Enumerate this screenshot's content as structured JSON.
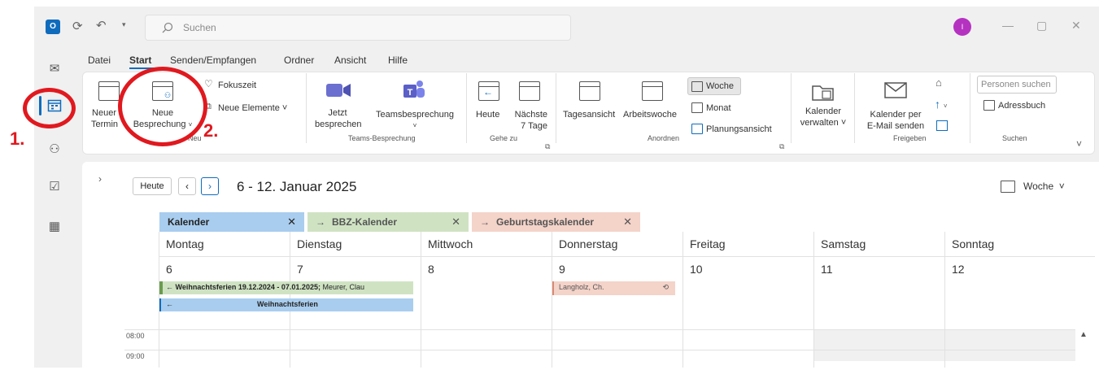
{
  "search": {
    "placeholder": "Suchen"
  },
  "avatar": {
    "initial": "I"
  },
  "menu": {
    "tabs": [
      "Datei",
      "Start",
      "Senden/Empfangen",
      "Ordner",
      "Ansicht",
      "Hilfe"
    ],
    "active": "Start"
  },
  "ribbon": {
    "new_appointment": "Neuer Termin",
    "new_meeting_line1": "Neue",
    "new_meeting_line2": "Besprechung",
    "focus_time": "Fokuszeit",
    "new_items": "Neue Elemente",
    "group_new": "Neu",
    "meet_now_line1": "Jetzt",
    "meet_now_line2": "besprechen",
    "teams_meeting": "Teamsbesprechung",
    "group_teams": "Teams-Besprechung",
    "today": "Heute",
    "next7_line1": "Nächste",
    "next7_line2": "7 Tage",
    "group_goto": "Gehe zu",
    "day_view": "Tagesansicht",
    "work_week": "Arbeitswoche",
    "week": "Woche",
    "month": "Monat",
    "schedule_view": "Planungsansicht",
    "group_arrange": "Anordnen",
    "manage_cal_line1": "Kalender",
    "manage_cal_line2": "verwalten",
    "email_cal_line1": "Kalender per",
    "email_cal_line2": "E-Mail senden",
    "group_share": "Freigeben",
    "people_search": "Personen suchen",
    "address_book": "Adressbuch",
    "group_search": "Suchen"
  },
  "calendar": {
    "today_button": "Heute",
    "date_range": "6 - 12. Januar 2025",
    "view": "Woche",
    "tabs": [
      {
        "label": "Kalender",
        "color": "#a9cdee"
      },
      {
        "label": "BBZ-Kalender",
        "color": "#cfe3c3"
      },
      {
        "label": "Geburtstagskalender",
        "color": "#f4d3c9"
      }
    ],
    "days": [
      "Montag",
      "Dienstag",
      "Mittwoch",
      "Donnerstag",
      "Freitag",
      "Samstag",
      "Sonntag"
    ],
    "dates": [
      "6",
      "7",
      "8",
      "9",
      "10",
      "11",
      "12"
    ],
    "events": [
      {
        "title": "Weihnachtsferien 19.12.2024 - 07.01.2025;",
        "extra": "Meurer, Clau",
        "color": "#cfe3c3"
      },
      {
        "title": "Weihnachtsferien",
        "color": "#a9cdee"
      },
      {
        "title": "Langholz, Ch.",
        "color": "#f4d3c9"
      }
    ],
    "hours": [
      "08:00",
      "09:00"
    ]
  },
  "annotations": {
    "step1": "1.",
    "step2": "2."
  }
}
